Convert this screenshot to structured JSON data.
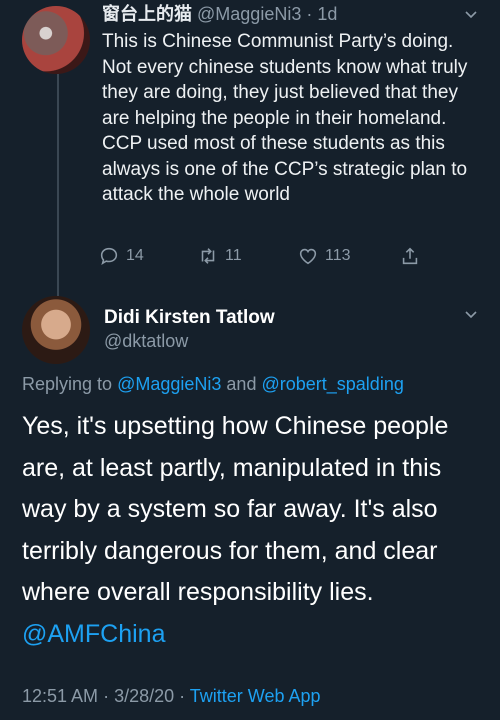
{
  "tweet1": {
    "name": "窗台上的猫",
    "handle": "@MaggieNi3",
    "time": "1d",
    "body": "This is Chinese Communist Party’s doing. Not every chinese students know what truly they are doing, they just believed that they are helping the people in their homeland.  CCP used most of these students as this always is one of the CCP’s strategic plan to attack the whole world",
    "replies": "14",
    "retweets": "11",
    "likes": "113"
  },
  "tweet2": {
    "name": "Didi Kirsten Tatlow",
    "handle": "@dktatlow",
    "replying_prefix": "Replying to",
    "replying_user1": "@MaggieNi3",
    "replying_and": "and",
    "replying_user2": "@robert_spalding",
    "body": "Yes, it's upsetting how Chinese people are, at least partly, manipulated in this way by a system so far away. It's also terribly dangerous for them, and clear where overall responsibility lies.",
    "mention": "@AMFChina",
    "time": "12:51 AM",
    "date": "3/28/20",
    "source": "Twitter Web App"
  },
  "icons": {
    "reply": "reply-icon",
    "retweet": "retweet-icon",
    "like": "heart-icon",
    "share": "share-icon",
    "caret": "chevron-down-icon"
  },
  "colors": {
    "background": "#15202b",
    "accent": "#1da1f2",
    "secondary_text": "#8c9aa7"
  }
}
